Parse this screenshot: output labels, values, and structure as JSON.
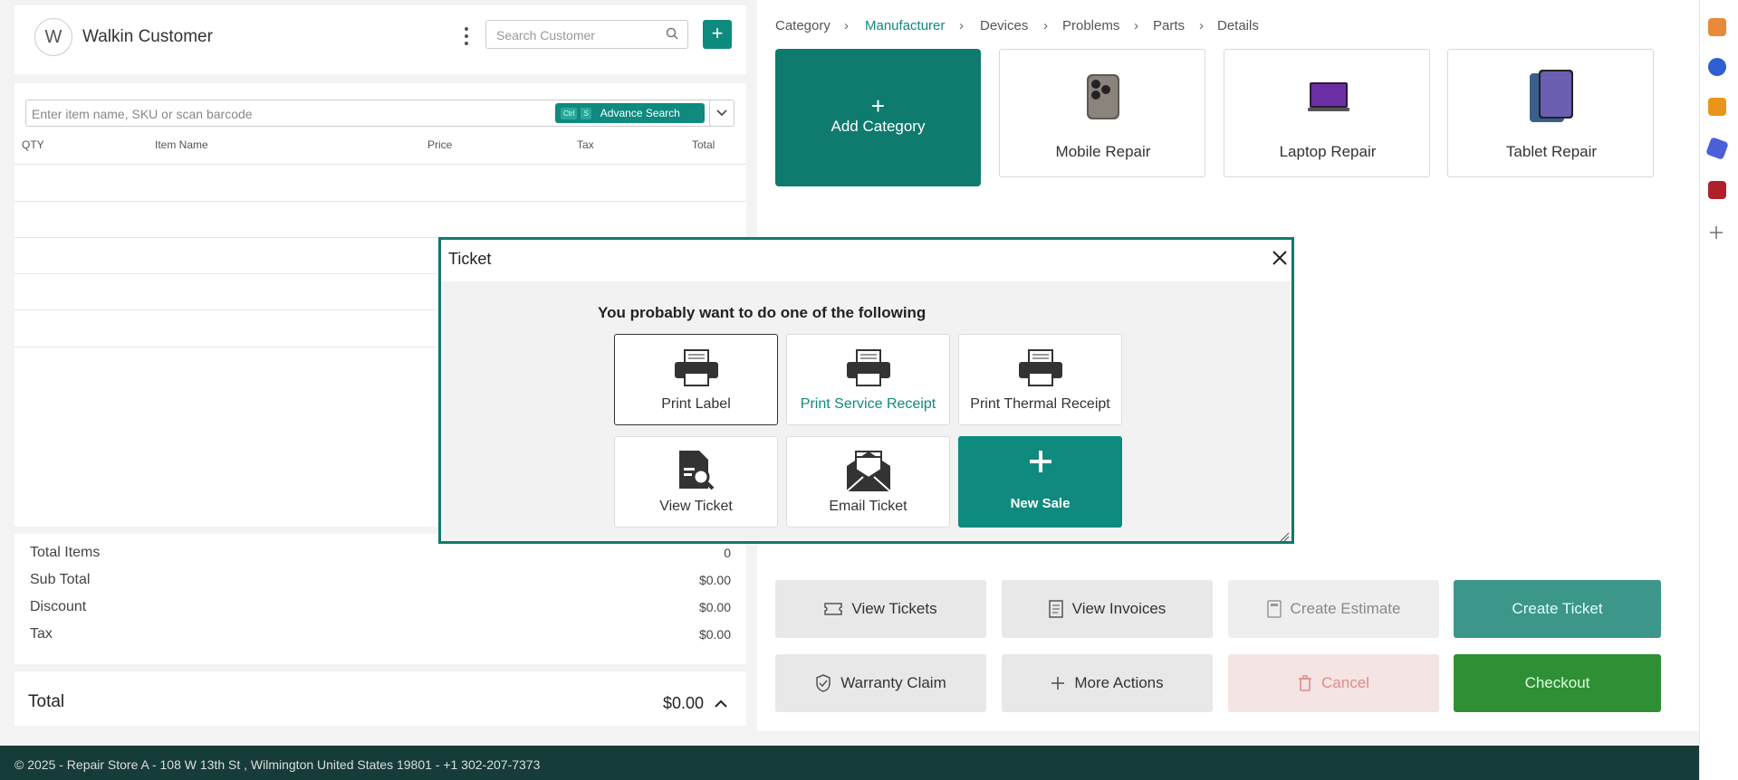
{
  "customer": {
    "avatar_letter": "W",
    "name": "Walkin Customer",
    "search_placeholder": "Search Customer",
    "add_label": "+"
  },
  "items": {
    "input_placeholder": "Enter item name, SKU or scan barcode",
    "adv_kbd1": "Ctrl",
    "adv_kbd2": "S",
    "adv_label": "Advance Search",
    "columns": [
      "QTY",
      "Item Name",
      "Price",
      "Tax",
      "Total"
    ]
  },
  "totals": {
    "total_items_label": "Total Items",
    "total_items_value": "0",
    "sub_total_label": "Sub Total",
    "sub_total_value": "$0.00",
    "discount_label": "Discount",
    "discount_value": "$0.00",
    "tax_label": "Tax",
    "tax_value": "$0.00",
    "total_label": "Total",
    "total_value": "$0.00"
  },
  "breadcrumb": [
    "Category",
    "Manufacturer",
    "Devices",
    "Problems",
    "Parts",
    "Details"
  ],
  "categories": {
    "add_plus": "+",
    "add_label": "Add Category",
    "cards": [
      "Mobile Repair",
      "Laptop Repair",
      "Tablet Repair"
    ]
  },
  "actions": {
    "view_tickets": "View Tickets",
    "view_invoices": "View Invoices",
    "create_estimate": "Create Estimate",
    "create_ticket": "Create Ticket",
    "warranty_claim": "Warranty Claim",
    "more_actions": "More Actions",
    "cancel": "Cancel",
    "checkout": "Checkout"
  },
  "modal": {
    "title": "Ticket",
    "subtitle": "You probably want to do one of the following",
    "options": {
      "print_label": "Print Label",
      "print_service_receipt": "Print Service Receipt",
      "print_thermal_receipt": "Print Thermal Receipt",
      "view_ticket": "View Ticket",
      "email_ticket": "Email Ticket",
      "new_sale": "New Sale"
    }
  },
  "footer": {
    "text": "© 2025 - Repair Store A - 108 W 13th St , Wilmington United States 19801 - +1 302-207-7373"
  },
  "colors": {
    "primary": "#0f8a7e",
    "checkout": "#2f8f35",
    "footer_bg": "#163c3a"
  }
}
